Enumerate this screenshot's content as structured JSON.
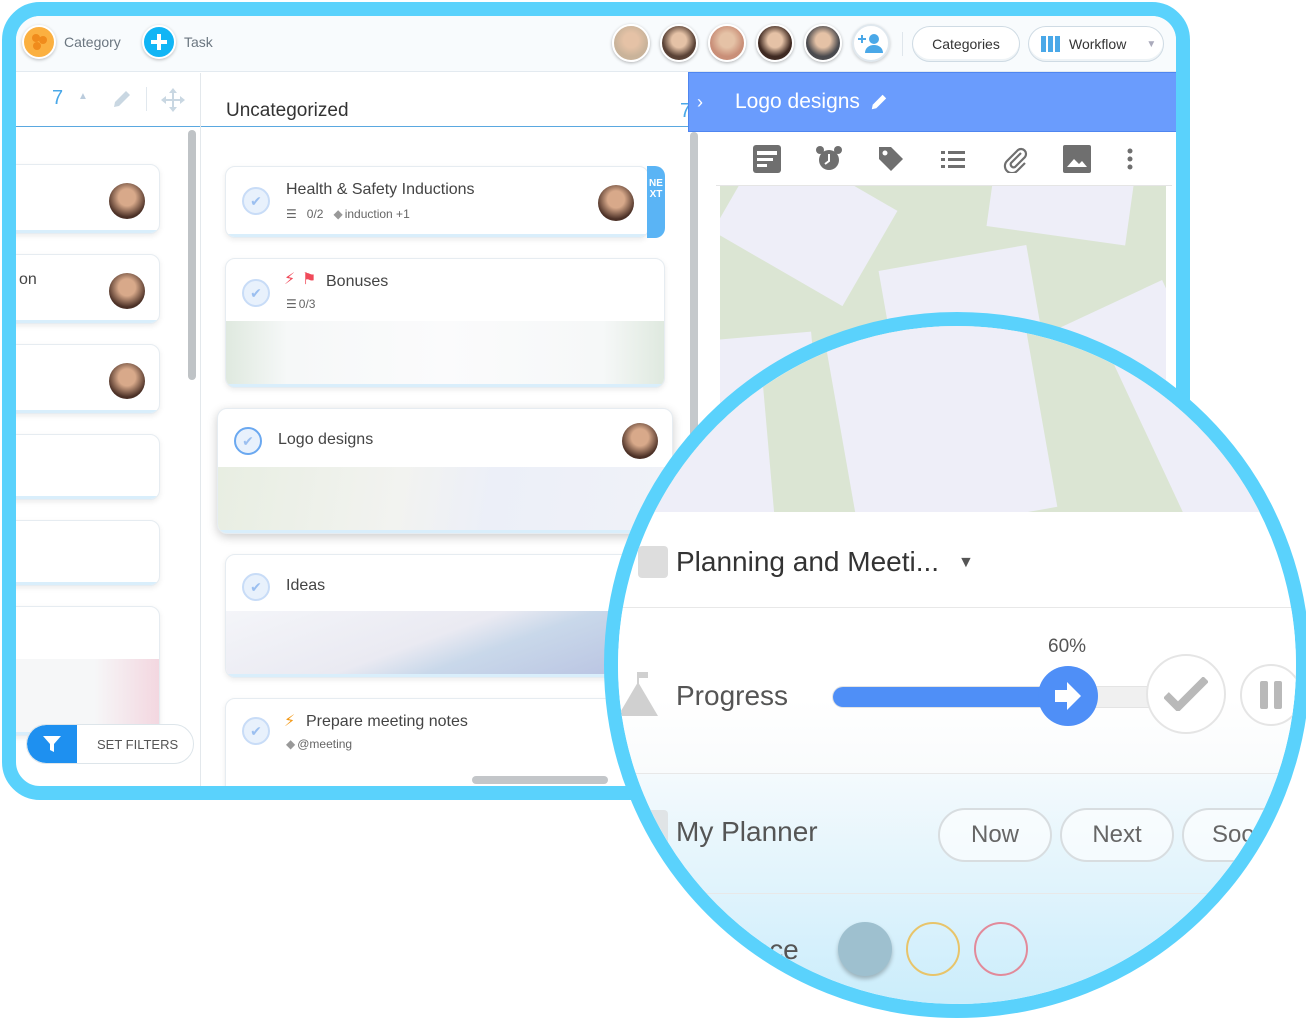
{
  "topbar": {
    "category_label": "Category",
    "task_label": "Task",
    "avatars": [
      {
        "name": "user-1",
        "color": "#c9b39a"
      },
      {
        "name": "user-2",
        "color": "#5a4236"
      },
      {
        "name": "user-3",
        "color": "#c98f78"
      },
      {
        "name": "user-4",
        "color": "#3f2a22"
      },
      {
        "name": "user-5",
        "color": "#4a4a4e"
      }
    ],
    "categories_label": "Categories",
    "workflow_label": "Workflow"
  },
  "left_column": {
    "count": "7",
    "partial_card_text": "on"
  },
  "middle_column": {
    "title": "Uncategorized",
    "count": "7",
    "cards": [
      {
        "title": "Health & Safety Inductions",
        "checklist": "0/2",
        "tag": "induction +1",
        "badge": "NEXT"
      },
      {
        "title": "Bonuses",
        "checklist": "0/3"
      },
      {
        "title": "Logo designs"
      },
      {
        "title": "Ideas"
      },
      {
        "title": "Prepare meeting notes",
        "tag": "@meeting"
      }
    ]
  },
  "filters": {
    "label": "SET FILTERS"
  },
  "detail_panel": {
    "title": "Logo designs",
    "tools": [
      "description-icon",
      "alarm-icon",
      "tag-icon",
      "checklist-icon",
      "attachment-icon",
      "image-icon",
      "more-icon"
    ]
  },
  "magnifier": {
    "category_select": "Planning and Meeti...",
    "progress_label": "Progress",
    "progress_value": 60,
    "progress_text": "60%",
    "planner_label": "My Planner",
    "planner_options": [
      "Now",
      "Next",
      "Soo"
    ],
    "importance_label": "ance",
    "importance_colors": [
      "#9ec0cf",
      "#e8c46a",
      "#e28a9a"
    ]
  },
  "colors": {
    "frame": "#5ad2fc",
    "accent_blue": "#6a9cfd",
    "slider_blue": "#4f8ff7",
    "category_orange": "#fbb040",
    "task_blue": "#11b5f5"
  }
}
